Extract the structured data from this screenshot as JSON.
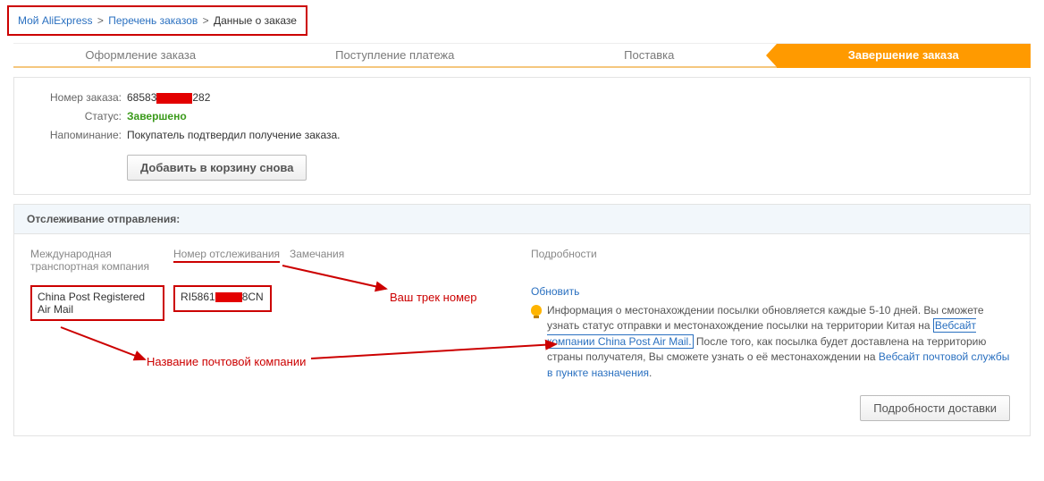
{
  "breadcrumb": {
    "my_ali": "Мой AliExpress",
    "order_list": "Перечень заказов",
    "current": "Данные о заказе"
  },
  "steps": {
    "s1": "Оформление заказа",
    "s2": "Поступление платежа",
    "s3": "Поставка",
    "s4": "Завершение заказа"
  },
  "order": {
    "number_label": "Номер заказа:",
    "number_prefix": "68583",
    "number_suffix": "282",
    "status_label": "Статус:",
    "status_value": "Завершено",
    "remind_label": "Напоминание:",
    "remind_value": "Покупатель подтвердил получение заказа.",
    "add_to_cart": "Добавить в корзину снова"
  },
  "tracking": {
    "section_title": "Отслеживание отправления:",
    "col_carrier": "Международная транспортная компания",
    "col_tracknum": "Номер отслеживания",
    "col_notes": "Замечания",
    "col_details": "Подробности",
    "carrier_value": "China Post Registered Air Mail",
    "track_prefix": "RI5861",
    "track_suffix": "8CN",
    "refresh": "Обновить",
    "info_1": "Информация о местонахождении посылки обновляется каждые 5-10 дней. Вы сможете узнать статус отправки и местонахождение посылки на территории Китая на ",
    "info_link1": "Вебсайт компании China Post Air Mail.",
    "info_2": " После того, как посылка будет доставлена на территорию страны получателя, Вы сможете узнать о её местонахождении на ",
    "info_link2": "Вебсайт почтовой службы в пункте назначения",
    "details_btn": "Подробности доставки"
  },
  "annotations": {
    "your_track": "Ваш трек номер",
    "company_name": "Название почтовой компании"
  }
}
